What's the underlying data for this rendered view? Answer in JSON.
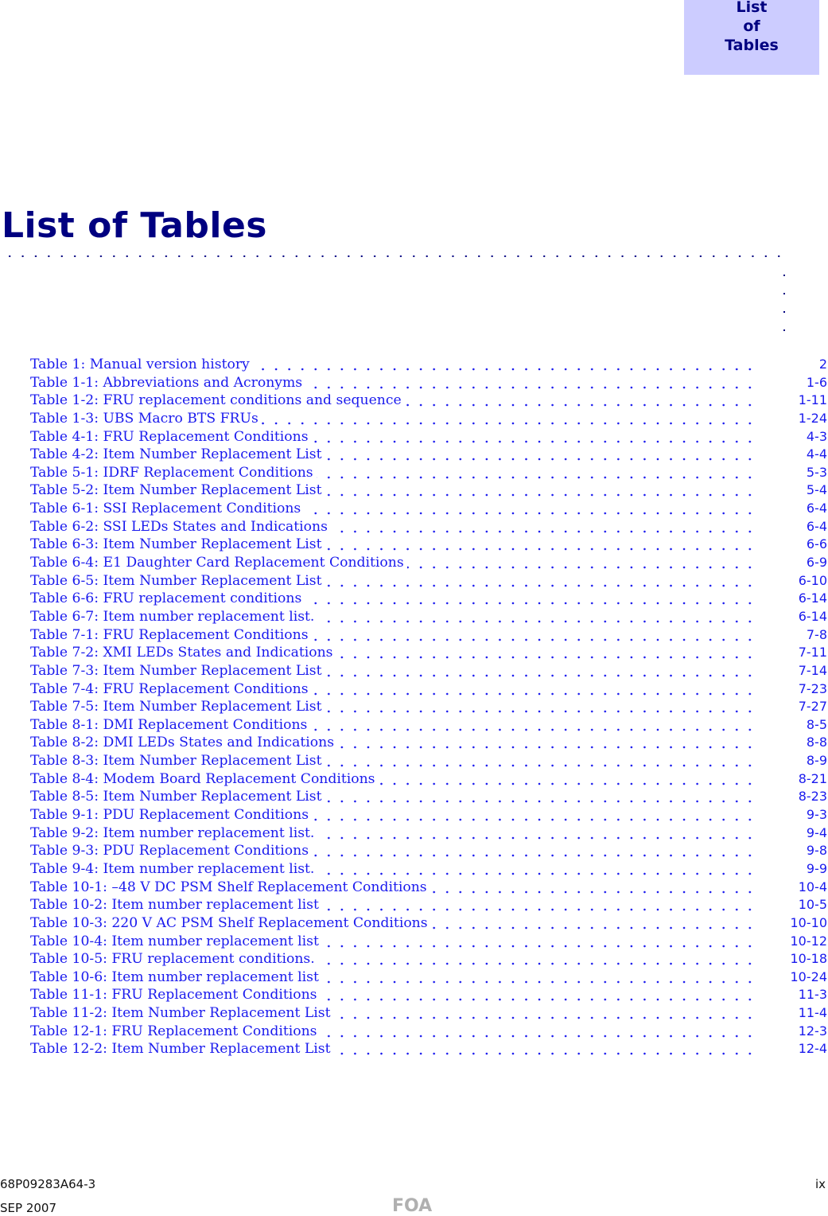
{
  "tab": {
    "line1": "List",
    "line2": "of",
    "line3": "Tables"
  },
  "page_title": "List of Tables",
  "entries": [
    {
      "label": "Table 1: Manual version history",
      "page": "2"
    },
    {
      "label": "Table 1-1: Abbreviations and Acronyms",
      "page": "1-6"
    },
    {
      "label": "Table 1-2: FRU replacement conditions and sequence",
      "page": "1-11"
    },
    {
      "label": "Table 1-3: UBS Macro BTS FRUs",
      "page": "1-24"
    },
    {
      "label": "Table 4-1: FRU Replacement Conditions",
      "page": "4-3"
    },
    {
      "label": "Table 4-2: Item Number Replacement List",
      "page": "4-4"
    },
    {
      "label": "Table 5-1: IDRF Replacement Conditions",
      "page": "5-3"
    },
    {
      "label": "Table 5-2: Item Number Replacement List",
      "page": "5-4"
    },
    {
      "label": "Table 6-1: SSI Replacement Conditions",
      "page": "6-4"
    },
    {
      "label": "Table 6-2: SSI LEDs States and Indications",
      "page": "6-4"
    },
    {
      "label": "Table 6-3: Item Number Replacement List",
      "page": "6-6"
    },
    {
      "label": "Table 6-4: E1 Daughter Card Replacement Conditions",
      "page": "6-9"
    },
    {
      "label": "Table 6-5: Item Number Replacement List",
      "page": "6-10"
    },
    {
      "label": "Table 6-6: FRU replacement conditions",
      "page": "6-14"
    },
    {
      "label": "Table 6-7: Item number replacement list.",
      "page": "6-14"
    },
    {
      "label": "Table 7-1: FRU Replacement Conditions",
      "page": "7-8"
    },
    {
      "label": "Table 7-2: XMI LEDs States and Indications",
      "page": "7-11"
    },
    {
      "label": "Table 7-3: Item Number Replacement List",
      "page": "7-14"
    },
    {
      "label": "Table 7-4: FRU Replacement Conditions",
      "page": "7-23"
    },
    {
      "label": "Table 7-5: Item Number Replacement List",
      "page": "7-27"
    },
    {
      "label": "Table 8-1: DMI Replacement Conditions",
      "page": "8-5"
    },
    {
      "label": "Table 8-2: DMI LEDs States and Indications",
      "page": "8-8"
    },
    {
      "label": "Table 8-3: Item Number Replacement List",
      "page": "8-9"
    },
    {
      "label": "Table 8-4: Modem Board Replacement Conditions",
      "page": "8-21"
    },
    {
      "label": "Table 8-5: Item Number Replacement List",
      "page": "8-23"
    },
    {
      "label": "Table 9-1: PDU Replacement Conditions",
      "page": "9-3"
    },
    {
      "label": "Table 9-2: Item number replacement list.",
      "page": "9-4"
    },
    {
      "label": "Table 9-3: PDU Replacement Conditions",
      "page": "9-8"
    },
    {
      "label": "Table 9-4: Item number replacement list.",
      "page": "9-9"
    },
    {
      "label": "Table 10-1: –48 V DC PSM Shelf Replacement Conditions",
      "page": "10-4"
    },
    {
      "label": "Table 10-2: Item number replacement list",
      "page": "10-5"
    },
    {
      "label": "Table 10-3: 220 V AC PSM Shelf Replacement Conditions",
      "page": "10-10"
    },
    {
      "label": "Table 10-4: Item number replacement list",
      "page": "10-12"
    },
    {
      "label": "Table 10-5: FRU replacement conditions.",
      "page": "10-18"
    },
    {
      "label": "Table 10-6: Item number replacement list",
      "page": "10-24"
    },
    {
      "label": "Table 11-1: FRU Replacement Conditions",
      "page": "11-3"
    },
    {
      "label": "Table 11-2: Item Number Replacement List",
      "page": "11-4"
    },
    {
      "label": "Table 12-1: FRU Replacement Conditions",
      "page": "12-3"
    },
    {
      "label": "Table 12-2: Item Number Replacement List",
      "page": "12-4"
    }
  ],
  "footer": {
    "doc_number": "68P09283A64-3",
    "date": "SEP 2007",
    "watermark": "FOA",
    "page_number": "ix"
  }
}
